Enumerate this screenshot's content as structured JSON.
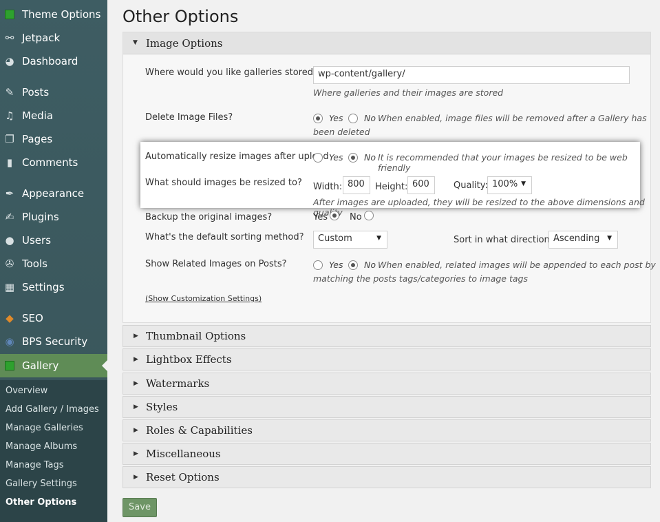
{
  "sidebar": {
    "items": [
      {
        "label": "Theme Options",
        "icon": "theme-options-icon"
      },
      {
        "label": "Jetpack",
        "icon": "jetpack-icon"
      },
      {
        "label": "Dashboard",
        "icon": "dashboard-icon"
      },
      {
        "label": "Posts",
        "icon": "pin-icon"
      },
      {
        "label": "Media",
        "icon": "media-icon"
      },
      {
        "label": "Pages",
        "icon": "pages-icon"
      },
      {
        "label": "Comments",
        "icon": "comments-icon"
      },
      {
        "label": "Appearance",
        "icon": "brush-icon"
      },
      {
        "label": "Plugins",
        "icon": "plugin-icon"
      },
      {
        "label": "Users",
        "icon": "user-icon"
      },
      {
        "label": "Tools",
        "icon": "wrench-icon"
      },
      {
        "label": "Settings",
        "icon": "settings-icon"
      },
      {
        "label": "SEO",
        "icon": "seo-icon"
      },
      {
        "label": "BPS Security",
        "icon": "bps-security-icon"
      },
      {
        "label": "Gallery",
        "icon": "gallery-icon"
      }
    ],
    "submenu": [
      "Overview",
      "Add Gallery / Images",
      "Manage Galleries",
      "Manage Albums",
      "Manage Tags",
      "Gallery Settings",
      "Other Options"
    ]
  },
  "page_title": "Other Options",
  "image_options": {
    "header": "Image Options",
    "gallery_path_label": "Where would you like galleries stored?",
    "gallery_path_value": "wp-content/gallery/",
    "gallery_path_desc": "Where galleries and their images are stored",
    "delete_label": "Delete Image Files?",
    "delete_yes": "Yes",
    "delete_no": "No",
    "delete_desc_1": "When enabled, image files will be removed after a Gallery has",
    "delete_desc_2": "been deleted",
    "resize_label": "Automatically resize images after upload",
    "resize_yes": "Yes",
    "resize_no": "No",
    "resize_desc": "It is recommended that your images be resized to be web friendly",
    "resize_to_label": "What should images be resized to?",
    "width_label": "Width:",
    "width_value": "800",
    "height_label": "Height:",
    "height_value": "600",
    "quality_label": "Quality:",
    "quality_value": "100%",
    "resize_to_desc": "After images are uploaded, they will be resized to the above dimensions and quality",
    "backup_label": "Backup the original images?",
    "backup_yes": "Yes",
    "backup_no": "No",
    "sort_label": "What's the default sorting method?",
    "sort_value": "Custom",
    "sort_dir_label": "Sort in what direction?",
    "sort_dir_value": "Ascending",
    "related_label": "Show Related Images on Posts?",
    "related_yes": "Yes",
    "related_no": "No",
    "related_desc_1": "When enabled, related images will be appended to each post by",
    "related_desc_2": "matching the posts tags/categories to image tags",
    "customization_link": "(Show Customization Settings)"
  },
  "sections": [
    "Thumbnail Options",
    "Lightbox Effects",
    "Watermarks",
    "Styles",
    "Roles & Capabilities",
    "Miscellaneous",
    "Reset Options"
  ],
  "save_label": "Save"
}
